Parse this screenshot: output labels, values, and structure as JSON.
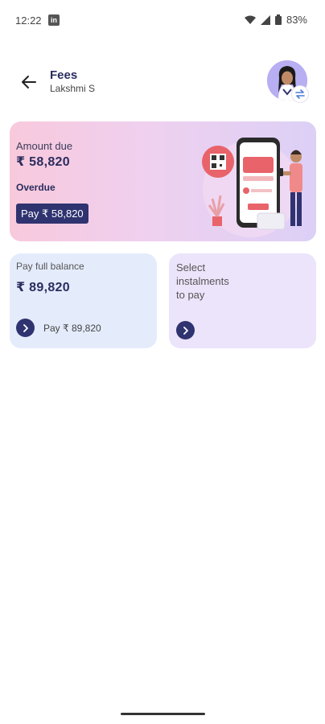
{
  "status_bar": {
    "time": "12:22",
    "app_icon": "linkedin-icon",
    "battery": "83%",
    "icons": [
      "wifi-icon",
      "signal-icon",
      "battery-icon"
    ]
  },
  "header": {
    "title": "Fees",
    "subtitle": "Lakshmi S",
    "back_icon": "arrow-left-icon",
    "switch_icon": "swap-icon"
  },
  "due_card": {
    "label": "Amount due",
    "amount": "₹ 58,820",
    "status": "Overdue",
    "pay_button": "Pay ₹ 58,820"
  },
  "options": {
    "full": {
      "label": "Pay full balance",
      "amount": "₹ 89,820",
      "pay_text": "Pay ₹ 89,820"
    },
    "instalments": {
      "label": "Select\ninstalments\nto pay"
    }
  },
  "colors": {
    "primary": "#2f3370",
    "accent": "#e8636a",
    "card_full": "#e4ecfc",
    "card_instalments": "#ece4fb"
  }
}
